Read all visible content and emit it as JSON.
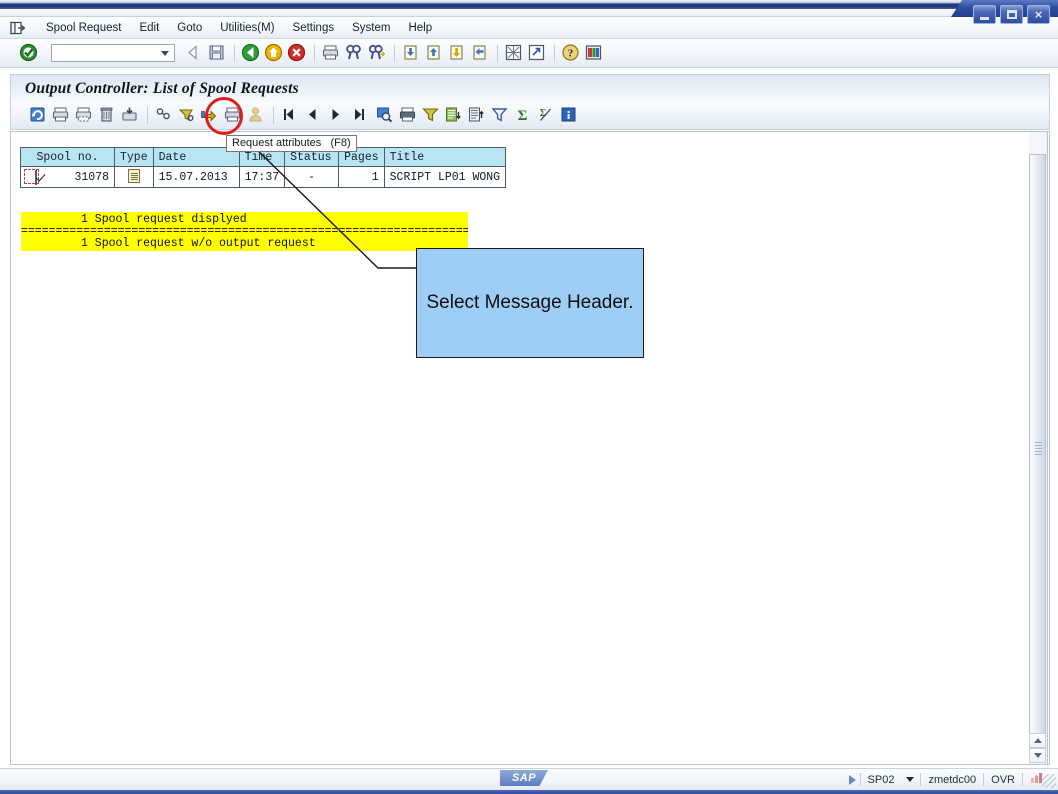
{
  "window": {
    "controls": [
      {
        "name": "minimize",
        "glyph": "minimize-icon"
      },
      {
        "name": "maximize",
        "glyph": "maximize-icon"
      },
      {
        "name": "close",
        "glyph": "close-icon",
        "label": "×"
      }
    ]
  },
  "menubar": {
    "system_icon": "sap-system-menu-icon",
    "items": [
      {
        "label": "Spool Request",
        "accel": "p"
      },
      {
        "label": "Edit",
        "accel": "E"
      },
      {
        "label": "Goto",
        "accel": "G"
      },
      {
        "label": "Utilities(M)",
        "accel": "M"
      },
      {
        "label": "Settings",
        "accel": "S"
      },
      {
        "label": "System",
        "accel": "y"
      },
      {
        "label": "Help",
        "accel": "H"
      }
    ]
  },
  "system_toolbar": {
    "enter_icon": "green-check-enter-icon",
    "command_field": {
      "value": "",
      "placeholder": ""
    },
    "icons": [
      "back-icon",
      "save-icon",
      "back-green-icon",
      "exit-yellow-icon",
      "cancel-red-icon",
      "print-icon",
      "find-icon",
      "find-next-icon",
      "first-page-icon",
      "previous-page-icon",
      "next-page-icon",
      "last-page-icon",
      "create-session-icon",
      "create-shortcut-icon",
      "help-icon",
      "customize-local-layout-icon"
    ]
  },
  "app_title": "Output Controller: List of Spool Requests",
  "app_toolbar": {
    "icons": [
      "refresh-icon",
      "print-output-icon",
      "print-with-changed-params-icon",
      "delete-icon",
      "export-icon",
      "display-contents-icon",
      "display-output-requests-icon",
      "forward-icon",
      "request-attributes-icon",
      "authorization-icon",
      "first-entry-icon",
      "previous-entry-icon",
      "next-entry-icon",
      "last-entry-icon",
      "find-icon",
      "print-icon",
      "filter-icon",
      "sort-ascending-icon",
      "sort-descending-icon",
      "set-filter-icon",
      "total-icon",
      "subtotal-icon",
      "details-info-icon"
    ],
    "highlighted_icon": "request-attributes-icon"
  },
  "tooltip": {
    "text": "Request attributes   (F8)"
  },
  "table": {
    "columns": [
      "Spool no.",
      "Type",
      "Date",
      "Time",
      "Status",
      "Pages",
      "Title"
    ],
    "rows": [
      {
        "selected": true,
        "spool_no": "31078",
        "type_icon": "document-type-icon",
        "date": "15.07.2013",
        "time": "17:37",
        "status": "-",
        "pages": "1",
        "title": "SCRIPT LP01 WONG"
      }
    ]
  },
  "messages": {
    "line1": "1 Spool request displyed",
    "separator": "=========================================================================================",
    "line2": "1 Spool request w/o output request",
    "background": "#ffff00"
  },
  "annotation": {
    "callout_text": "Select Message Header.",
    "callout_bg": "#9ecdf5",
    "circle_color": "#e01b1b"
  },
  "status_bar": {
    "logo": "SAP",
    "play_icon": "status-play-icon",
    "system": "SP02",
    "client": "zmetdc00",
    "insert_mode": "OVR"
  }
}
